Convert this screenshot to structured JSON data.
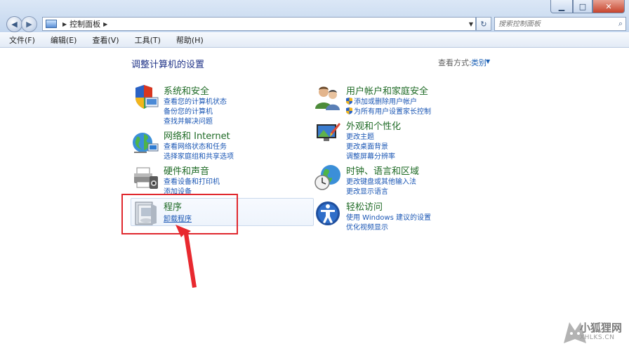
{
  "window": {
    "minimize_icon": "minimize-icon",
    "maximize_icon": "maximize-icon",
    "close_icon": "close-icon"
  },
  "address_bar": {
    "location": "控制面板",
    "search_placeholder": "搜索控制面板"
  },
  "menu": {
    "items": [
      "文件(F)",
      "编辑(E)",
      "查看(V)",
      "工具(T)",
      "帮助(H)"
    ]
  },
  "main": {
    "title": "调整计算机的设置",
    "view_by_label": "查看方式:",
    "view_by_value": "类别"
  },
  "categories": [
    {
      "title": "系统和安全",
      "icon": "shield-icon",
      "links": [
        "查看您的计算机状态",
        "备份您的计算机",
        "查找并解决问题"
      ]
    },
    {
      "title": "网络和 Internet",
      "icon": "network-icon",
      "links": [
        "查看网络状态和任务",
        "选择家庭组和共享选项"
      ]
    },
    {
      "title": "硬件和声音",
      "icon": "printer-icon",
      "links": [
        "查看设备和打印机",
        "添加设备"
      ]
    },
    {
      "title": "程序",
      "icon": "programs-icon",
      "links": [
        "卸载程序"
      ]
    },
    {
      "title": "用户帐户和家庭安全",
      "icon": "users-icon",
      "links": [
        "添加或删除用户帐户",
        "为所有用户设置家长控制"
      ]
    },
    {
      "title": "外观和个性化",
      "icon": "appearance-icon",
      "links": [
        "更改主题",
        "更改桌面背景",
        "调整屏幕分辨率"
      ]
    },
    {
      "title": "时钟、语言和区域",
      "icon": "clock-globe-icon",
      "links": [
        "更改键盘或其他输入法",
        "更改显示语言"
      ]
    },
    {
      "title": "轻松访问",
      "icon": "ease-of-access-icon",
      "links": [
        "使用 Windows 建议的设置",
        "优化视频显示"
      ]
    }
  ],
  "watermark": {
    "cn": "小狐狸网",
    "en": "XHLKS.CN"
  },
  "colors": {
    "title_blue": "#1e3287",
    "category_green": "#1e6a25",
    "link_blue": "#1a56b4",
    "highlight_red": "#e0282e"
  }
}
